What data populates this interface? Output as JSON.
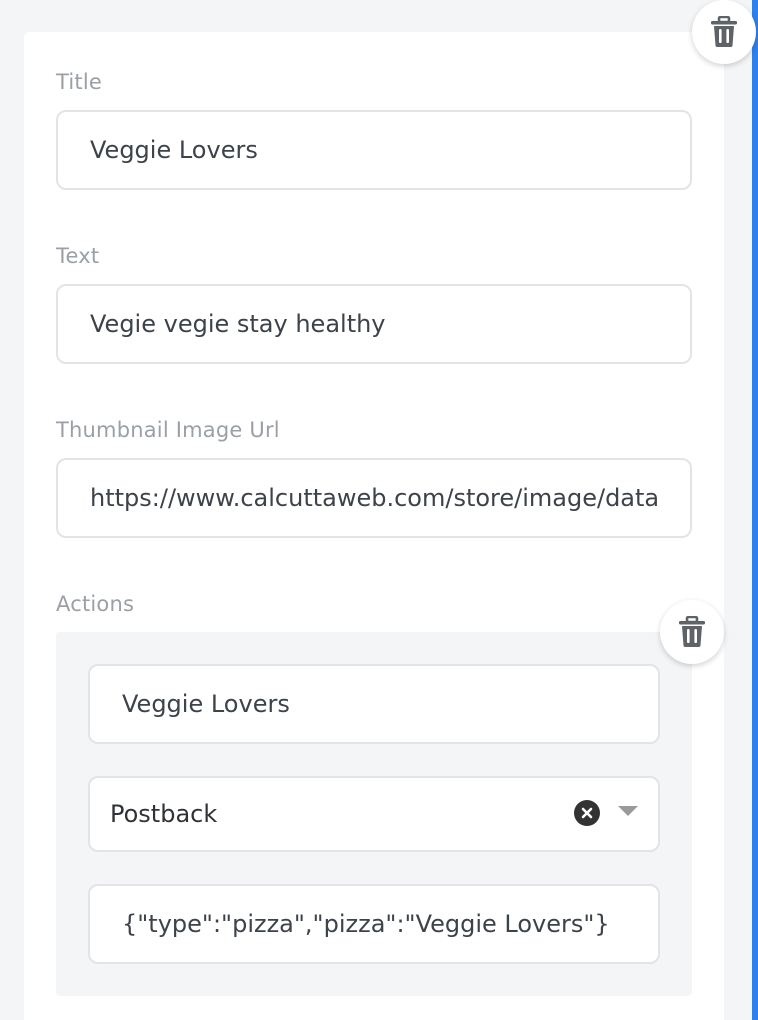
{
  "form": {
    "title_label": "Title",
    "title_value": "Veggie Lovers",
    "text_label": "Text",
    "text_value": "Vegie vegie stay healthy",
    "thumbnail_label": "Thumbnail Image Url",
    "thumbnail_value": "https://www.calcuttaweb.com/store/image/data",
    "actions_label": "Actions"
  },
  "action": {
    "label_value": "Veggie Lovers",
    "type_value": "Postback",
    "payload_value": "{\"type\":\"pizza\",\"pizza\":\"Veggie Lovers\"}"
  },
  "icons": {
    "card_delete": "trash-icon",
    "action_delete": "trash-icon",
    "clear": "clear-x-icon",
    "dropdown": "chevron-down-icon"
  },
  "colors": {
    "accent_border": "#2f80ed",
    "icon": "#5f6368",
    "label": "#9aa0a6"
  }
}
